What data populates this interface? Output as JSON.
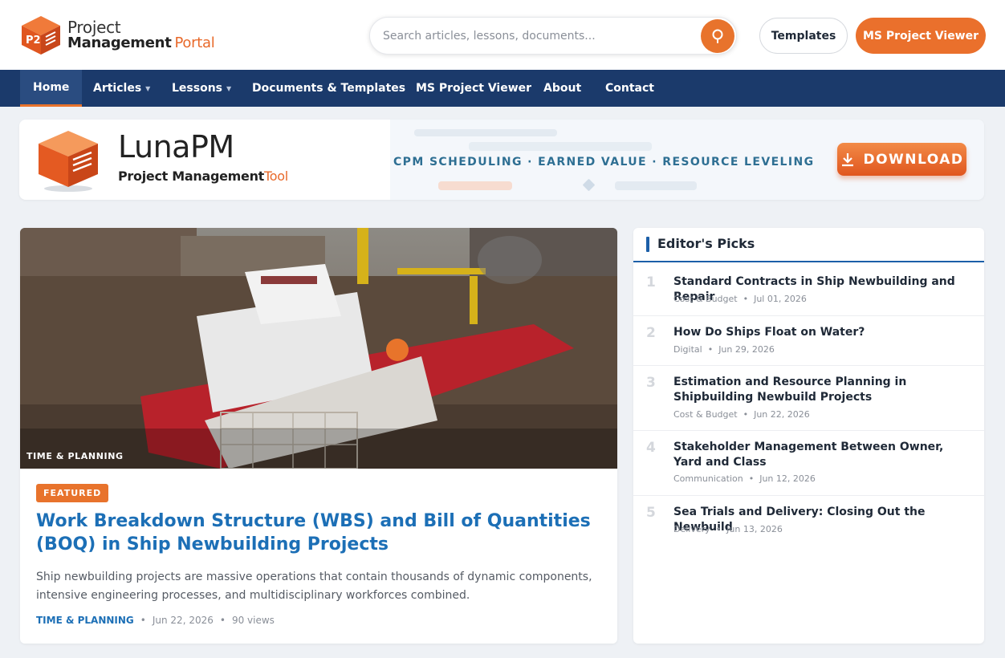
{
  "header": {
    "logo_line1": "Project",
    "logo_line2a": "Management",
    "logo_line2b": "Portal",
    "search_placeholder": "Search articles, lessons, documents...",
    "templates_label": "Templates",
    "ms_viewer_label": "MS Project Viewer"
  },
  "nav": {
    "items": [
      {
        "label": "Home",
        "active": true
      },
      {
        "label": "Articles",
        "dropdown": true
      },
      {
        "label": "Lessons",
        "dropdown": true
      },
      {
        "label": "Documents & Templates"
      },
      {
        "label": "MS Project Viewer"
      },
      {
        "label": "About"
      },
      {
        "label": "Contact"
      }
    ],
    "caret": "▼"
  },
  "banner": {
    "title": "LunaPM",
    "subtitle_a": "Project Management",
    "subtitle_b": "Tool",
    "tagline": "CPM SCHEDULING · EARNED VALUE · RESOURCE LEVELING",
    "download_label": "DOWNLOAD"
  },
  "featured": {
    "image_tag": "TIME & PLANNING",
    "badge": "FEATURED",
    "title": "Work Breakdown Structure (WBS) and Bill of Quantities (BOQ) in Ship Newbuilding Projects",
    "excerpt": "Ship newbuilding projects are massive operations that contain thousands of dynamic components, intensive engineering processes, and multidisciplinary workforces combined.",
    "category": "TIME & PLANNING",
    "date": "Jun 22, 2026",
    "views": "90 views"
  },
  "picks": {
    "heading": "Editor's Picks",
    "items": [
      {
        "num": "1",
        "title": "Standard Contracts in Ship Newbuilding and Repair",
        "category": "Cost & Budget",
        "date": "Jul 01, 2026"
      },
      {
        "num": "2",
        "title": "How Do Ships Float on Water?",
        "category": "Digital",
        "date": "Jun 29, 2026"
      },
      {
        "num": "3",
        "title": "Estimation and Resource Planning in Shipbuilding Newbuild Projects",
        "category": "Cost & Budget",
        "date": "Jun 22, 2026"
      },
      {
        "num": "4",
        "title": "Stakeholder Management Between Owner, Yard and Class",
        "category": "Communication",
        "date": "Jun 12, 2026"
      },
      {
        "num": "5",
        "title": "Sea Trials and Delivery: Closing Out the Newbuild",
        "category": "Delivery",
        "date": "Jun 13, 2026"
      }
    ]
  },
  "colors": {
    "brand_orange": "#e8732c",
    "nav_blue": "#1b3a6b",
    "link_blue": "#1c6fb6"
  },
  "icons": [
    "logo-cube-icon",
    "search-icon",
    "download-icon"
  ]
}
